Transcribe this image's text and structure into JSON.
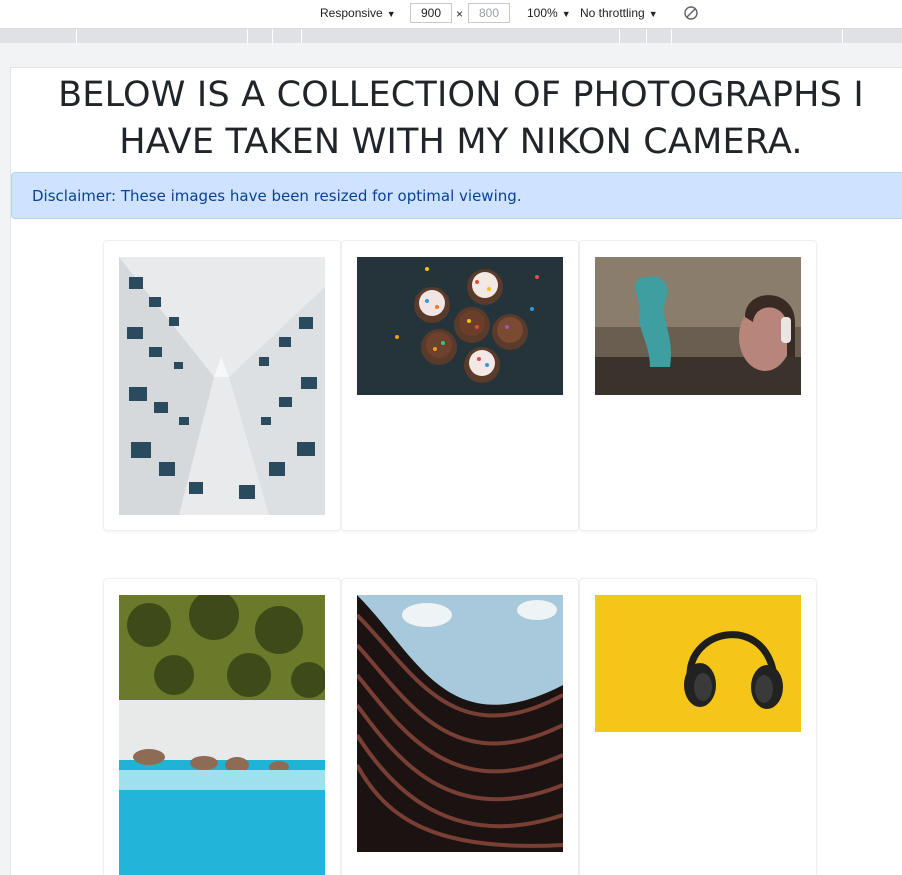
{
  "devtools": {
    "device": "Responsive",
    "width": "900",
    "separator": "×",
    "height": "800",
    "zoom": "100%",
    "throttling": "No throttling",
    "rotate_icon": "rotate-icon"
  },
  "page": {
    "heading": "BELOW IS A COLLECTION OF PHOTOGRAPHS I HAVE TAKEN WITH MY NIKON CAMERA.",
    "disclaimer": "Disclaimer: These images have been resized for optimal viewing."
  },
  "gallery": {
    "photos": [
      {
        "subject": "building"
      },
      {
        "subject": "cupcakes"
      },
      {
        "subject": "graffiti-person"
      },
      {
        "subject": "palm-beach"
      },
      {
        "subject": "curved-building"
      },
      {
        "subject": "headphones"
      }
    ]
  },
  "colors": {
    "alert_bg": "#cfe2ff",
    "alert_text": "#084298",
    "heading_text": "#212529"
  }
}
